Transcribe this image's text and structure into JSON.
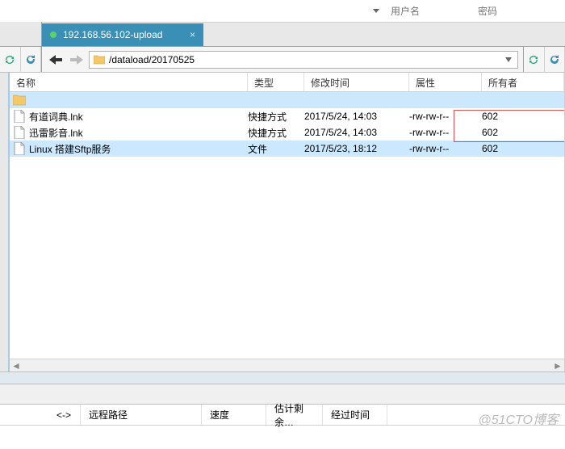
{
  "top": {
    "user_ph": "用户名",
    "pass_ph": "密码"
  },
  "tab": {
    "label": "192.168.56.102-upload"
  },
  "nav": {
    "path": "/dataload/20170525"
  },
  "columns": {
    "name": "名称",
    "type": "类型",
    "mtime": "修改时间",
    "perm": "属性",
    "owner": "所有者"
  },
  "files": [
    {
      "icon": "folder",
      "name": "",
      "type": "",
      "mtime": "",
      "perm": "",
      "owner": "",
      "sel": true
    },
    {
      "icon": "file",
      "name": "有道词典.lnk",
      "type": "快捷方式",
      "mtime": "2017/5/24, 14:03",
      "perm": "-rw-rw-r--",
      "owner": "602"
    },
    {
      "icon": "file",
      "name": "迅雷影音.lnk",
      "type": "快捷方式",
      "mtime": "2017/5/24, 14:03",
      "perm": "-rw-rw-r--",
      "owner": "602"
    },
    {
      "icon": "file",
      "name": "Linux 搭建Sftp服务",
      "type": "文件",
      "mtime": "2017/5/23, 18:12",
      "perm": "-rw-rw-r--",
      "owner": "602",
      "sel": true
    }
  ],
  "status": {
    "dir": "<->",
    "path": "远程路径",
    "speed": "速度",
    "remain": "估计剩余…",
    "elapsed": "经过时间"
  },
  "watermark": "@51CTO博客"
}
